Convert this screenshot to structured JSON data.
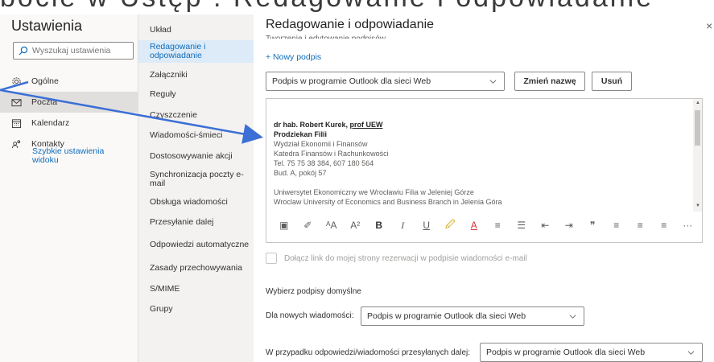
{
  "caption": {
    "cropped_text": "bocie w Ustęp . Redagowanie i odpowiadanie"
  },
  "left": {
    "title": "Ustawienia",
    "search_placeholder": "Wyszukaj ustawienia",
    "nav": [
      {
        "label": "Ogólne",
        "icon": "gear-icon"
      },
      {
        "label": "Poczta",
        "icon": "mail-icon"
      },
      {
        "label": "Kalendarz",
        "icon": "calendar-icon"
      },
      {
        "label": "Kontakty",
        "icon": "people-icon"
      }
    ],
    "quick_link": "Szybkie ustawienia widoku"
  },
  "middle": {
    "items": [
      "Układ",
      "Redagowanie i odpowiadanie",
      "Załączniki",
      "Reguły",
      "Czyszczenie",
      "Wiadomości-śmieci",
      "Dostosowywanie akcji",
      "Synchronizacja poczty e-mail",
      "Obsługa wiadomości",
      "Przesyłanie dalej",
      "Odpowiedzi automatyczne",
      "Zasady przechowywania",
      "S/MIME",
      "Grupy"
    ]
  },
  "content": {
    "title": "Redagowanie i odpowiadanie",
    "close": "×",
    "cut_heading": "Tworzenie i edytowanie podpisów",
    "new_signature": "+ Nowy podpis",
    "signature_select": "Podpis w programie Outlook dla sieci Web",
    "rename_button": "Zmień nazwę",
    "delete_button": "Usuń",
    "signature": {
      "name": "dr hab. Robert Kurek,",
      "name_title": "prof UEW",
      "role": "Prodziekan Filii",
      "lines": [
        "Wydział Ekonomii i Finansów",
        "Katedra Finansów i Rachunkowości",
        "Tel. 75 75 38 384, 607 180 564",
        "Bud. A, pokój 57"
      ],
      "footer": [
        "Uniwersytet Ekonomiczny we Wrocławiu Filia w Jeleniej Górze",
        "Wroclaw University of Economics and Business Branch in Jelenia Góra"
      ]
    },
    "toolbar_glyphs": [
      "▣",
      "✐",
      "ᴬA",
      "A²",
      "B",
      "I",
      "U",
      "🖉",
      "A",
      "≡",
      "☰",
      "⇤",
      "⇥",
      "❞",
      "≡",
      "≡",
      "≡",
      "···"
    ],
    "checkbox_label": "Dołącz link do mojej strony rezerwacji w podpisie wiadomości e-mail",
    "defaults_title": "Wybierz podpisy domyślne",
    "new_messages_label": "Dla nowych wiadomości:",
    "new_messages_value": "Podpis w programie Outlook dla sieci Web",
    "reply_label": "W przypadku odpowiedzi/wiadomości przesyłanych dalej:",
    "reply_value": "Podpis w programie Outlook dla sieci Web"
  },
  "colors": {
    "accent": "#0f6cbd",
    "arrow": "#3b6fd6",
    "selected_bg": "#dcebf7"
  }
}
